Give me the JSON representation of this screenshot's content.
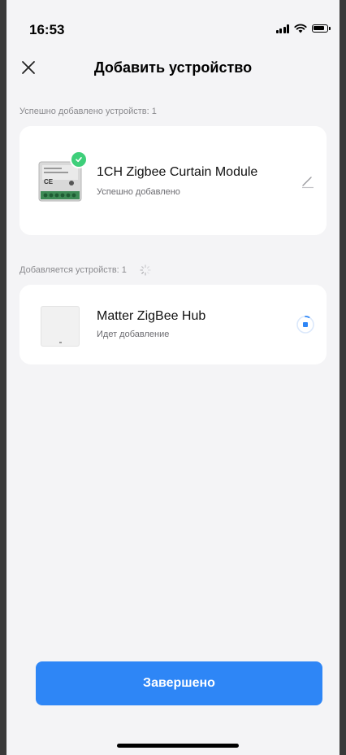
{
  "status_bar": {
    "time": "16:53"
  },
  "header": {
    "title": "Добавить устройство",
    "close_icon": "close-icon"
  },
  "success_section": {
    "label": "Успешно добавлено устройств: 1",
    "device": {
      "name": "1CH Zigbee Curtain Module",
      "status": "Успешно добавлено"
    }
  },
  "adding_section": {
    "label": "Добавляется устройств: 1",
    "device": {
      "name": "Matter ZigBee Hub",
      "status": "Идет добавление"
    }
  },
  "footer": {
    "done_label": "Завершено"
  },
  "colors": {
    "accent": "#2e86f6",
    "success": "#3ecf7a",
    "background": "#f4f4f6"
  }
}
